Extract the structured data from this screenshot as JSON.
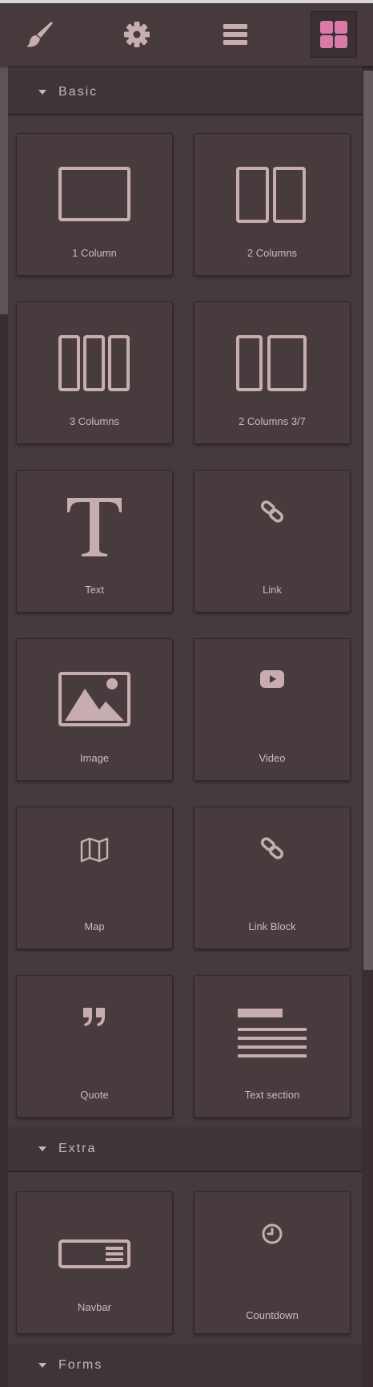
{
  "toolbar": {
    "buttons": [
      {
        "name": "style-manager",
        "icon": "paint-brush-icon"
      },
      {
        "name": "settings",
        "icon": "gear-icon"
      },
      {
        "name": "layer-manager",
        "icon": "bars-icon"
      },
      {
        "name": "blocks",
        "icon": "grid-icon",
        "active": true
      }
    ]
  },
  "categories": [
    {
      "label": "Basic",
      "blocks": [
        {
          "label": "1 Column",
          "icon": "one-column-icon"
        },
        {
          "label": "2 Columns",
          "icon": "two-columns-icon"
        },
        {
          "label": "3 Columns",
          "icon": "three-columns-icon"
        },
        {
          "label": "2 Columns 3/7",
          "icon": "two-columns-3-7-icon"
        },
        {
          "label": "Text",
          "icon": "text-icon"
        },
        {
          "label": "Link",
          "icon": "link-icon"
        },
        {
          "label": "Image",
          "icon": "image-icon"
        },
        {
          "label": "Video",
          "icon": "video-icon"
        },
        {
          "label": "Map",
          "icon": "map-icon"
        },
        {
          "label": "Link Block",
          "icon": "link-icon"
        },
        {
          "label": "Quote",
          "icon": "quote-icon"
        },
        {
          "label": "Text section",
          "icon": "text-section-icon"
        }
      ]
    },
    {
      "label": "Extra",
      "blocks": [
        {
          "label": "Navbar",
          "icon": "navbar-icon"
        },
        {
          "label": "Countdown",
          "icon": "clock-icon"
        }
      ]
    },
    {
      "label": "Forms",
      "blocks": []
    }
  ],
  "colors": {
    "icon": "#c7adb0",
    "active_icon": "#d97ba6",
    "panel": "#453a3d",
    "block": "#473b3e",
    "text": "#c9bcbf"
  }
}
